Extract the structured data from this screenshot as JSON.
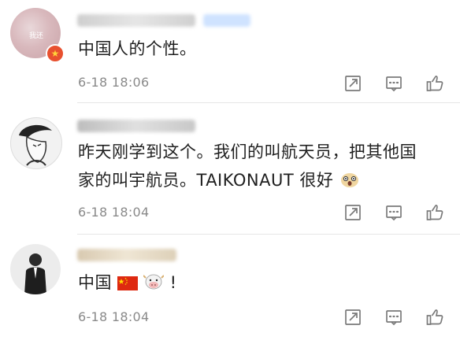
{
  "comments": [
    {
      "text": "中国人的个性。",
      "time": "6-18 18:06",
      "avatar_label": "我还"
    },
    {
      "text_line1": "昨天刚学到这个。我们的叫航天员，把其他国",
      "text_line2": "家的叫宇航员。TAIKONAUT 很好",
      "time": "6-18 18:04"
    },
    {
      "text_prefix": "中国",
      "text_suffix": "!",
      "time": "6-18 18:04"
    }
  ],
  "actions": [
    "share-icon",
    "comment-icon",
    "like-icon"
  ],
  "colors": {
    "timestamp": "#8a8a8a",
    "icon": "#7a7a7a",
    "badge": "#e8502f",
    "flag_red": "#de2910",
    "flag_yellow": "#ffde00"
  }
}
